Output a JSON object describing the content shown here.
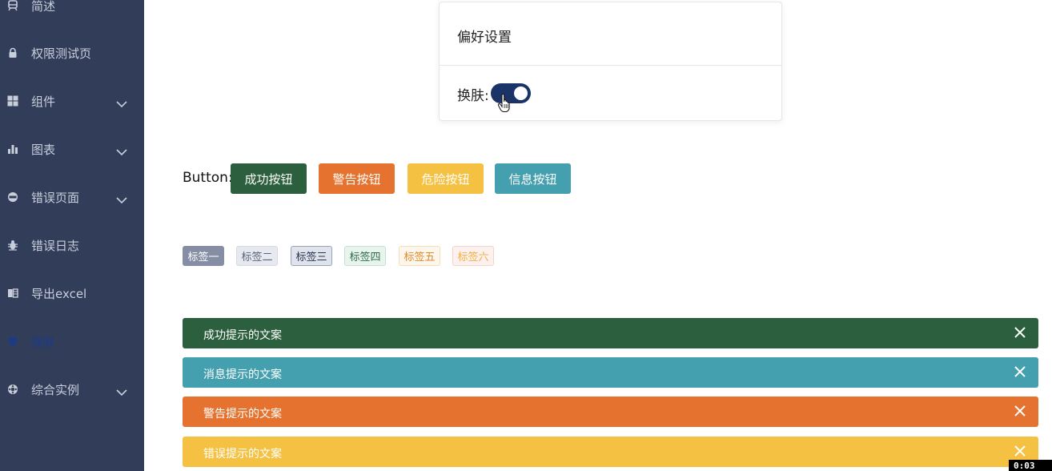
{
  "sidebar": {
    "items": [
      {
        "label": "简述",
        "icon": "train-icon"
      },
      {
        "label": "权限测试页",
        "icon": "lock-icon"
      },
      {
        "label": "组件",
        "icon": "grid-icon",
        "expandable": true
      },
      {
        "label": "图表",
        "icon": "bar-chart-icon",
        "expandable": true
      },
      {
        "label": "错误页面",
        "icon": "error-404-icon",
        "expandable": true
      },
      {
        "label": "错误日志",
        "icon": "bug-icon"
      },
      {
        "label": "导出excel",
        "icon": "excel-icon"
      },
      {
        "label": "换肤",
        "icon": "tshirt-icon",
        "active": true
      },
      {
        "label": "综合实例",
        "icon": "component-icon",
        "expandable": true
      }
    ],
    "colors": {
      "background": "#323d5a",
      "text": "#c9cedb",
      "active": "#1c3a86"
    }
  },
  "preferences": {
    "title": "偏好设置",
    "skin_label": "换肤:",
    "skin_toggle_on": true
  },
  "buttons": {
    "label": "Button:",
    "items": [
      {
        "label": "成功按钮",
        "color": "#2b5f3e"
      },
      {
        "label": "警告按钮",
        "color": "#e5732f"
      },
      {
        "label": "危险按钮",
        "color": "#f5c142"
      },
      {
        "label": "信息按钮",
        "color": "#44a0ae"
      }
    ]
  },
  "tags": [
    {
      "label": "标签一",
      "bg": "#868ea6",
      "border": "#868ea6",
      "color": "#ffffff"
    },
    {
      "label": "标签二",
      "bg": "#e6e9f0",
      "border": "#d5d9e2",
      "color": "#5a6478"
    },
    {
      "label": "标签三",
      "bg": "#dfe3ec",
      "border": "#9aa3b8",
      "color": "#2b3550"
    },
    {
      "label": "标签四",
      "bg": "#eaf4ee",
      "border": "#c6e2cf",
      "color": "#2b6e46"
    },
    {
      "label": "标签五",
      "bg": "#fdf6ec",
      "border": "#f6dfb8",
      "color": "#e08a2b"
    },
    {
      "label": "标签六",
      "bg": "#fdf1f0",
      "border": "#f6d2cf",
      "color": "#f2b13c"
    }
  ],
  "alerts": [
    {
      "text": "成功提示的文案",
      "color": "#2b5f3e"
    },
    {
      "text": "消息提示的文案",
      "color": "#44a0ae"
    },
    {
      "text": "警告提示的文案",
      "color": "#e5732f"
    },
    {
      "text": "错误提示的文案",
      "color": "#f5c142"
    }
  ],
  "video_timecode": "0:03"
}
